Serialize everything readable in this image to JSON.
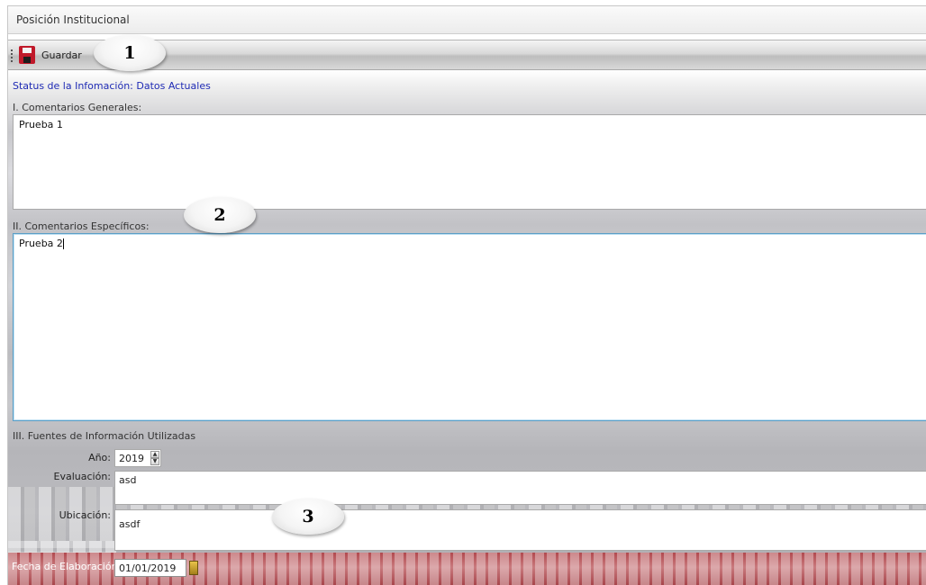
{
  "window": {
    "title": "Posición Institucional"
  },
  "toolbar": {
    "save_label": "Guardar",
    "save_icon": "floppy-disk-icon"
  },
  "status": {
    "text": "Status de la Infomación: Datos Actuales",
    "color": "#1f2bb5"
  },
  "sections": {
    "general": {
      "label": "I. Comentarios Generales:",
      "value": "Prueba 1"
    },
    "specific": {
      "label": "II. Comentarios Específicos:",
      "value": "Prueba 2"
    },
    "sources": {
      "label": "III. Fuentes de Información Utilizadas",
      "anio_label": "Año:",
      "anio_value": "2019",
      "evaluacion_label": "Evaluación:",
      "evaluacion_value": "asd",
      "ubicacion_label": "Ubicación:",
      "ubicacion_value": "asdf"
    },
    "fecha": {
      "label": "Fecha de Elaboración:",
      "value": "01/01/2019",
      "icon": "calendar-icon"
    }
  },
  "callouts": [
    "1",
    "2",
    "3"
  ]
}
